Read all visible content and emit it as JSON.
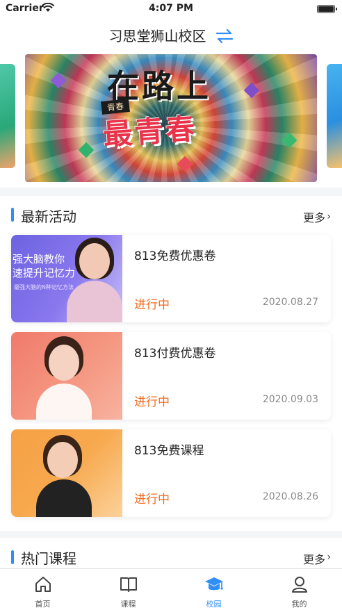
{
  "status_bar": {
    "carrier": "Carrier",
    "time": "4:07 PM"
  },
  "header": {
    "title": "习思堂狮山校区"
  },
  "banner": {
    "headline": "在路上",
    "tag": "青春",
    "slogan": "最青春"
  },
  "latest_activities": {
    "heading": "最新活动",
    "more": "更多",
    "items": [
      {
        "name": "813免费优惠卷",
        "status": "进行中",
        "date": "2020.08.27",
        "promo": {
          "line1": "强大脑教你",
          "line2": "速提升记忆力",
          "line3": "最强大脑的N种记忆方法"
        }
      },
      {
        "name": "813付费优惠卷",
        "status": "进行中",
        "date": "2020.09.03"
      },
      {
        "name": "813免费课程",
        "status": "进行中",
        "date": "2020.08.26"
      }
    ]
  },
  "hot_courses": {
    "heading": "热门课程",
    "more": "更多"
  },
  "tab_bar": {
    "tabs": [
      {
        "label": "首页",
        "icon": "home-icon"
      },
      {
        "label": "课程",
        "icon": "book-icon"
      },
      {
        "label": "校园",
        "icon": "graduation-cap-icon"
      },
      {
        "label": "我的",
        "icon": "user-icon"
      }
    ],
    "active_index": 2
  },
  "colors": {
    "accent": "#2f8ff7",
    "status_orange": "#f06b22"
  }
}
